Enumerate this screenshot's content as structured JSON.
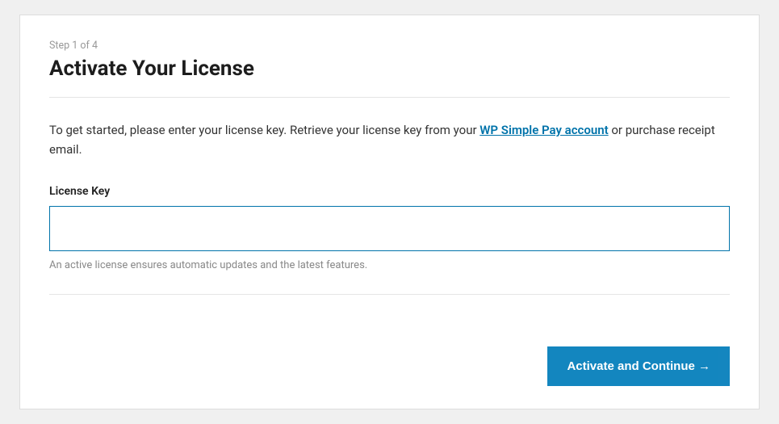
{
  "header": {
    "step_label": "Step 1 of 4",
    "title": "Activate Your License"
  },
  "intro": {
    "text_before": "To get started, please enter your license key. Retrieve your license key from your ",
    "link_text": "WP Simple Pay account",
    "text_after": " or purchase receipt email."
  },
  "form": {
    "field_label": "License Key",
    "field_value": "",
    "helper_text": "An active license ensures automatic updates and the latest features."
  },
  "footer": {
    "submit_label": "Activate and Continue →"
  }
}
